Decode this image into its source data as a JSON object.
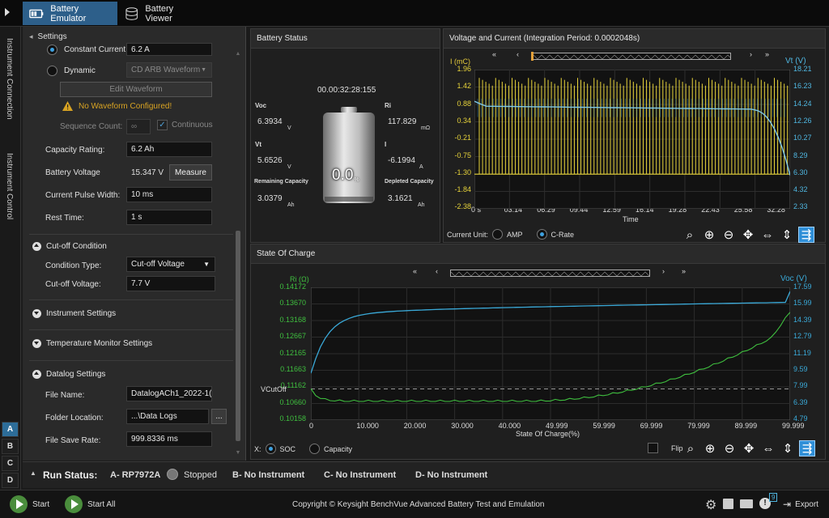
{
  "tabs": [
    {
      "label": "Battery Emulator",
      "active": true
    },
    {
      "label": "Battery Viewer",
      "active": false
    }
  ],
  "side_tabs": [
    "Instrument Connection",
    "Instrument Control"
  ],
  "channel_letters": [
    "A",
    "B",
    "C",
    "D"
  ],
  "settings": {
    "title": "Settings",
    "constant_current_label": "Constant Current:",
    "constant_current_value": "6.2 A",
    "dynamic_label": "Dynamic",
    "dynamic_select": "CD ARB Waveform",
    "edit_waveform": "Edit Waveform",
    "warning": "No Waveform Configured!",
    "sequence_count_label": "Sequence Count:",
    "sequence_count_value": "∞",
    "continuous_label": "Continuous",
    "capacity_rating_label": "Capacity Rating:",
    "capacity_rating_value": "6.2 Ah",
    "battery_voltage_label": "Battery Voltage",
    "battery_voltage_value": "15.347 V",
    "measure_label": "Measure",
    "pulse_width_label": "Current Pulse Width:",
    "pulse_width_value": "10 ms",
    "rest_time_label": "Rest Time:",
    "rest_time_value": "1 s",
    "cutoff_section": "Cut-off Condition",
    "condition_type_label": "Condition Type:",
    "condition_type_value": "Cut-off Voltage",
    "cutoff_voltage_label": "Cut-off Voltage:",
    "cutoff_voltage_value": "7.7 V",
    "instrument_settings": "Instrument Settings",
    "temperature_settings": "Temperature Monitor Settings",
    "datalog_section": "Datalog Settings",
    "file_name_label": "File Name:",
    "file_name_value": "DatalogACh1_2022-1(",
    "folder_label": "Folder Location:",
    "folder_value": "...\\Data Logs",
    "browse_label": "...",
    "save_rate_label": "File Save Rate:",
    "save_rate_value": "999.8336 ms"
  },
  "battery_status": {
    "title": "Battery Status",
    "timer": "00.00:32:28:155",
    "percent": "0.0",
    "percent_unit": "%",
    "voc_label": "Voc",
    "voc_value": "6.3934",
    "voc_unit": "V",
    "vt_label": "Vt",
    "vt_value": "5.6526",
    "vt_unit": "V",
    "rem_label": "Remaining Capacity",
    "rem_value": "3.0379",
    "rem_unit": "Ah",
    "ri_label": "Ri",
    "ri_value": "117.829",
    "ri_unit": "mΩ",
    "i_label": "I",
    "i_value": "-6.1994",
    "i_unit": "A",
    "dep_label": "Depleted Capacity",
    "dep_value": "3.1621",
    "dep_unit": "Ah"
  },
  "vc_chart": {
    "title": "Voltage and Current (Integration Period: 0.0002048s)",
    "left_label": "I (mC)",
    "right_label": "Vt (V)",
    "x_label": "Time",
    "left_ticks": [
      "1.96",
      "1.42",
      "0.88",
      "0.34",
      "-0.21",
      "-0.75",
      "-1.30",
      "-1.84",
      "-2.38"
    ],
    "right_ticks": [
      "18.21",
      "16.23",
      "14.24",
      "12.26",
      "10.27",
      "8.29",
      "6.30",
      "4.32",
      "2.33"
    ],
    "x_ticks": [
      "0 s",
      "03:14",
      "06:29",
      "09:44",
      "12:59",
      "16:14",
      "19:28",
      "22:43",
      "25:58",
      "32:28"
    ],
    "current_unit_label": "Current Unit:",
    "amp_label": "AMP",
    "crate_label": "C-Rate",
    "current_color": "#e6d23a",
    "voltage_color": "#7ec8e8"
  },
  "soc_chart": {
    "title": "State Of Charge",
    "left_label": "Ri (Ω)",
    "right_label": "Voc (V)",
    "x_label": "State Of Charge(%)",
    "cutoff_label": "VCutOff",
    "left_ticks": [
      "0.14172",
      "0.13670",
      "0.13168",
      "0.12667",
      "0.12165",
      "0.11663",
      "0.11162",
      "0.10660",
      "0.10158"
    ],
    "right_ticks": [
      "17.59",
      "15.99",
      "14.39",
      "12.79",
      "11.19",
      "9.59",
      "7.99",
      "6.39",
      "4.79"
    ],
    "x_ticks": [
      "0",
      "10.000",
      "20.000",
      "30.000",
      "40.000",
      "49.999",
      "59.999",
      "69.999",
      "79.999",
      "89.999",
      "99.999"
    ],
    "x_axis_label": "X:",
    "soc_label": "SOC",
    "capacity_label": "Capacity",
    "flip_label": "Flip",
    "ri_color": "#3fbf3f",
    "voc_color": "#3aa9d8"
  },
  "run_status": {
    "label": "Run Status:",
    "channels": [
      "A- RP7972A",
      "B- No Instrument",
      "C- No Instrument",
      "D- No Instrument"
    ],
    "state": "Stopped"
  },
  "bottom": {
    "start_label": "Start",
    "start_all_label": "Start All",
    "copyright": "Copyright © Keysight BenchVue Advanced Battery Test and Emulation",
    "export_label": "Export",
    "alert_count": "9"
  }
}
